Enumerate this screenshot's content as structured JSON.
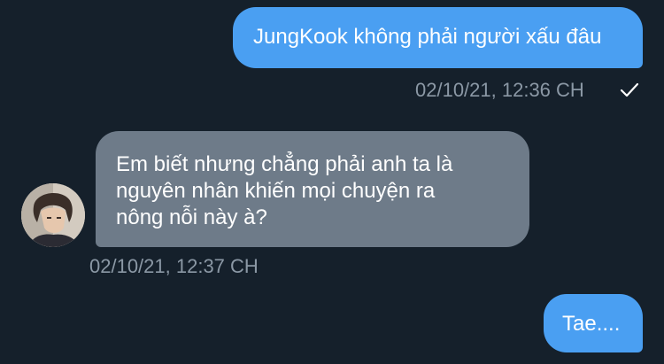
{
  "conversation": {
    "messages": [
      {
        "direction": "sent",
        "text": "JungKook không phải người xấu đâu",
        "timestamp": "02/10/21, 12:36 CH",
        "status_icon": "check-icon"
      },
      {
        "direction": "received",
        "lines": [
          "Em biết nhưng chẳng phải anh ta là",
          "nguyên nhân khiến mọi chuyện ra",
          "nông nỗi này à?"
        ],
        "timestamp": "02/10/21, 12:37 CH",
        "avatar_icon": "user-avatar"
      },
      {
        "direction": "sent",
        "text": "Tae...."
      }
    ]
  },
  "colors": {
    "background": "#15202b",
    "sent_bubble": "#4a9ff2",
    "received_bubble": "#6e7b89",
    "timestamp": "#8b98a5"
  }
}
